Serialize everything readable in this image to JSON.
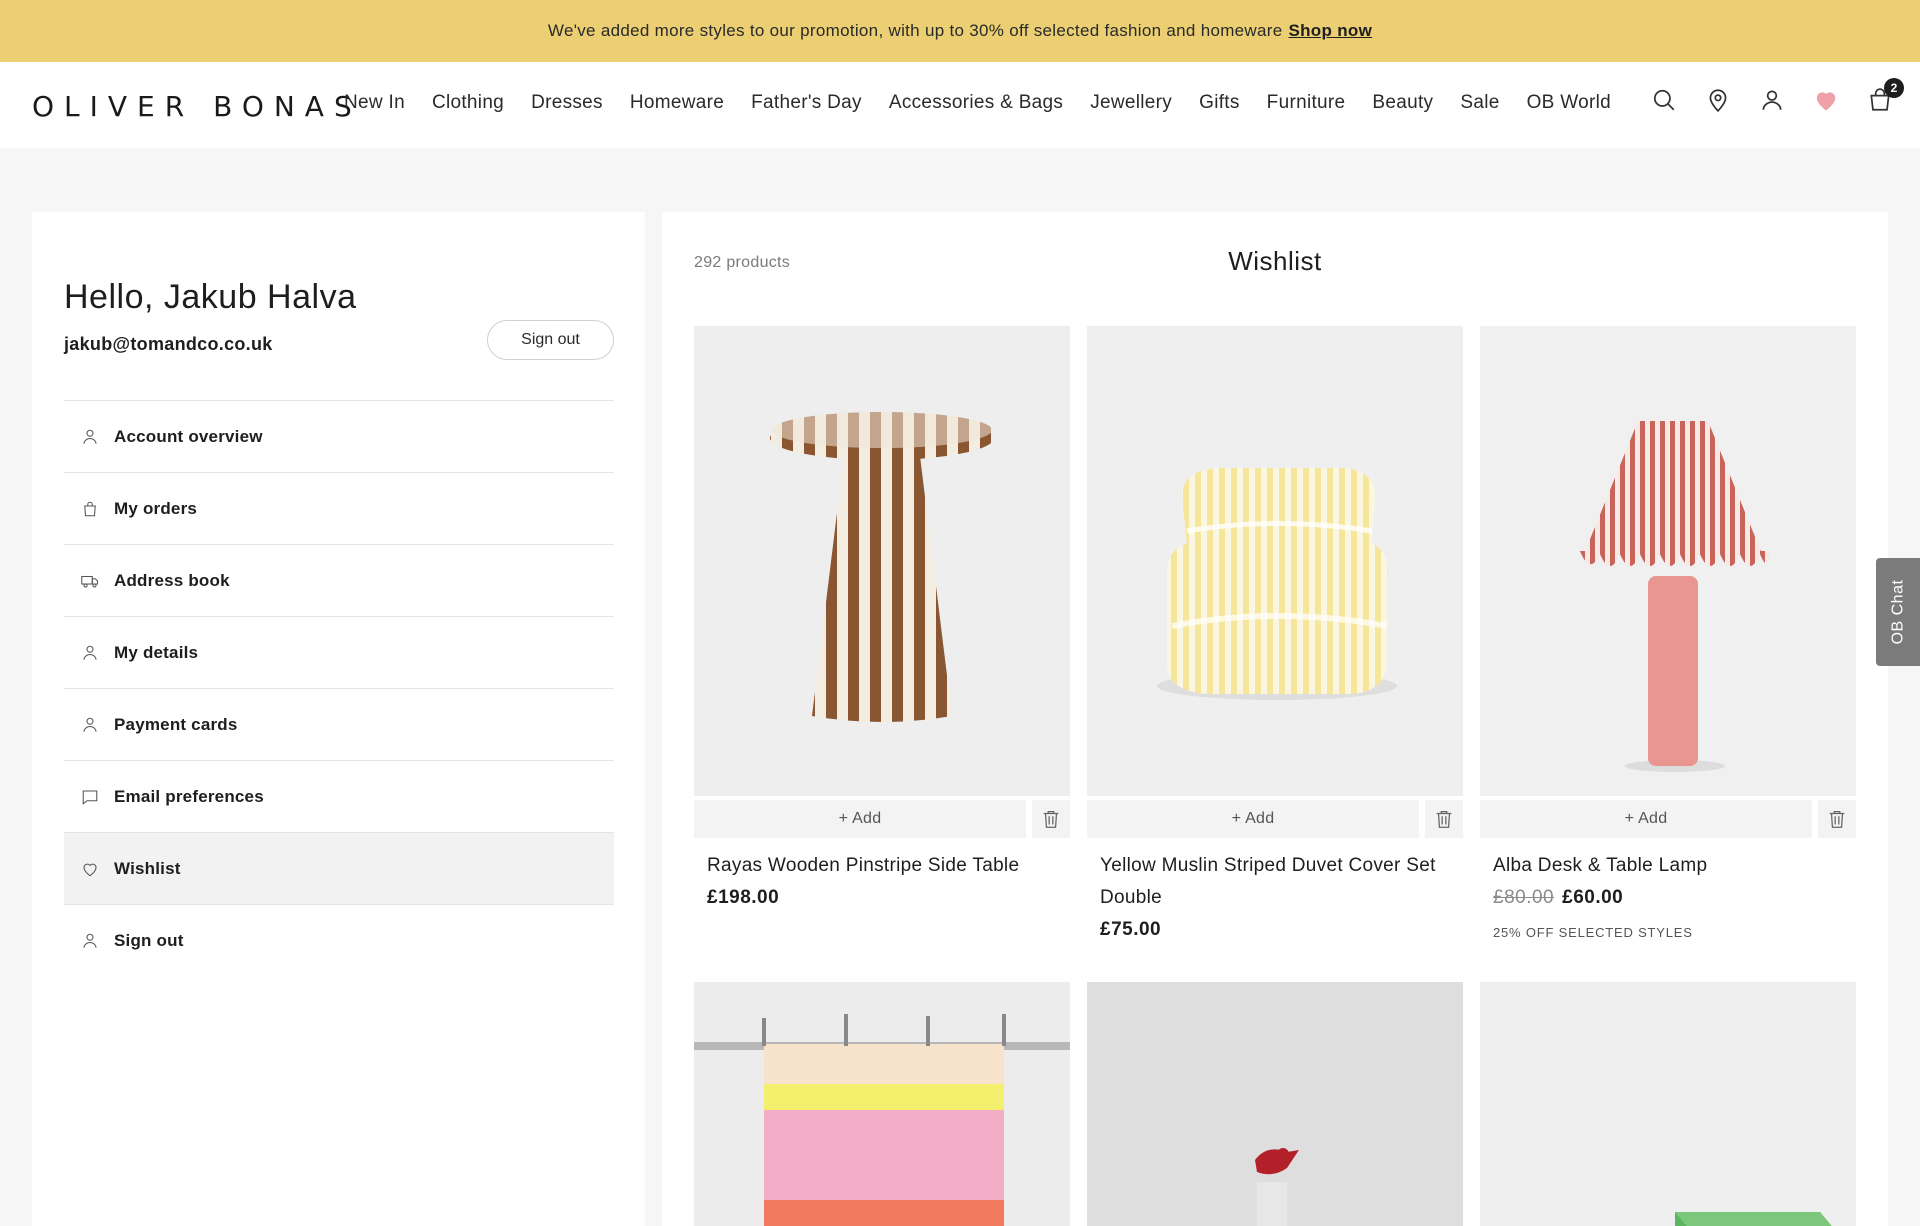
{
  "promo": {
    "text": "We've added more styles to our promotion, with up to 30% off selected fashion and homeware",
    "link": "Shop now"
  },
  "header": {
    "logo": "OLIVER BONAS",
    "nav": [
      "New In",
      "Clothing",
      "Dresses",
      "Homeware",
      "Father's Day",
      "Accessories & Bags",
      "Jewellery",
      "Gifts",
      "Furniture",
      "Beauty",
      "Sale",
      "OB World"
    ],
    "cart_count": "2",
    "icons": [
      "search-icon",
      "store-locator-icon",
      "account-icon",
      "wishlist-heart-icon",
      "basket-icon"
    ],
    "heart_color": "#f0a0a8"
  },
  "account": {
    "greeting": "Hello, Jakub Halva",
    "email": "jakub@tomandco.co.uk",
    "signout_button": "Sign out",
    "menu": [
      {
        "label": "Account overview",
        "icon": "person-icon"
      },
      {
        "label": "My orders",
        "icon": "bag-icon"
      },
      {
        "label": "Address book",
        "icon": "truck-icon"
      },
      {
        "label": "My details",
        "icon": "person-icon"
      },
      {
        "label": "Payment cards",
        "icon": "person-icon"
      },
      {
        "label": "Email preferences",
        "icon": "chat-icon"
      },
      {
        "label": "Wishlist",
        "icon": "heart-icon",
        "active": true
      },
      {
        "label": "Sign out",
        "icon": "person-icon"
      }
    ]
  },
  "wishlist": {
    "count": "292 products",
    "title": "Wishlist",
    "add_label": "+  Add",
    "products": [
      {
        "name": "Rayas Wooden Pinstripe Side Table",
        "price": "£198.00"
      },
      {
        "name": "Yellow Muslin Striped Duvet Cover Set Double",
        "price": "£75.00"
      },
      {
        "name": "Alba Desk & Table Lamp",
        "was": "£80.00",
        "price": "£60.00",
        "promo": "25% OFF SELECTED STYLES"
      }
    ]
  },
  "chat": {
    "label": "OB Chat"
  }
}
